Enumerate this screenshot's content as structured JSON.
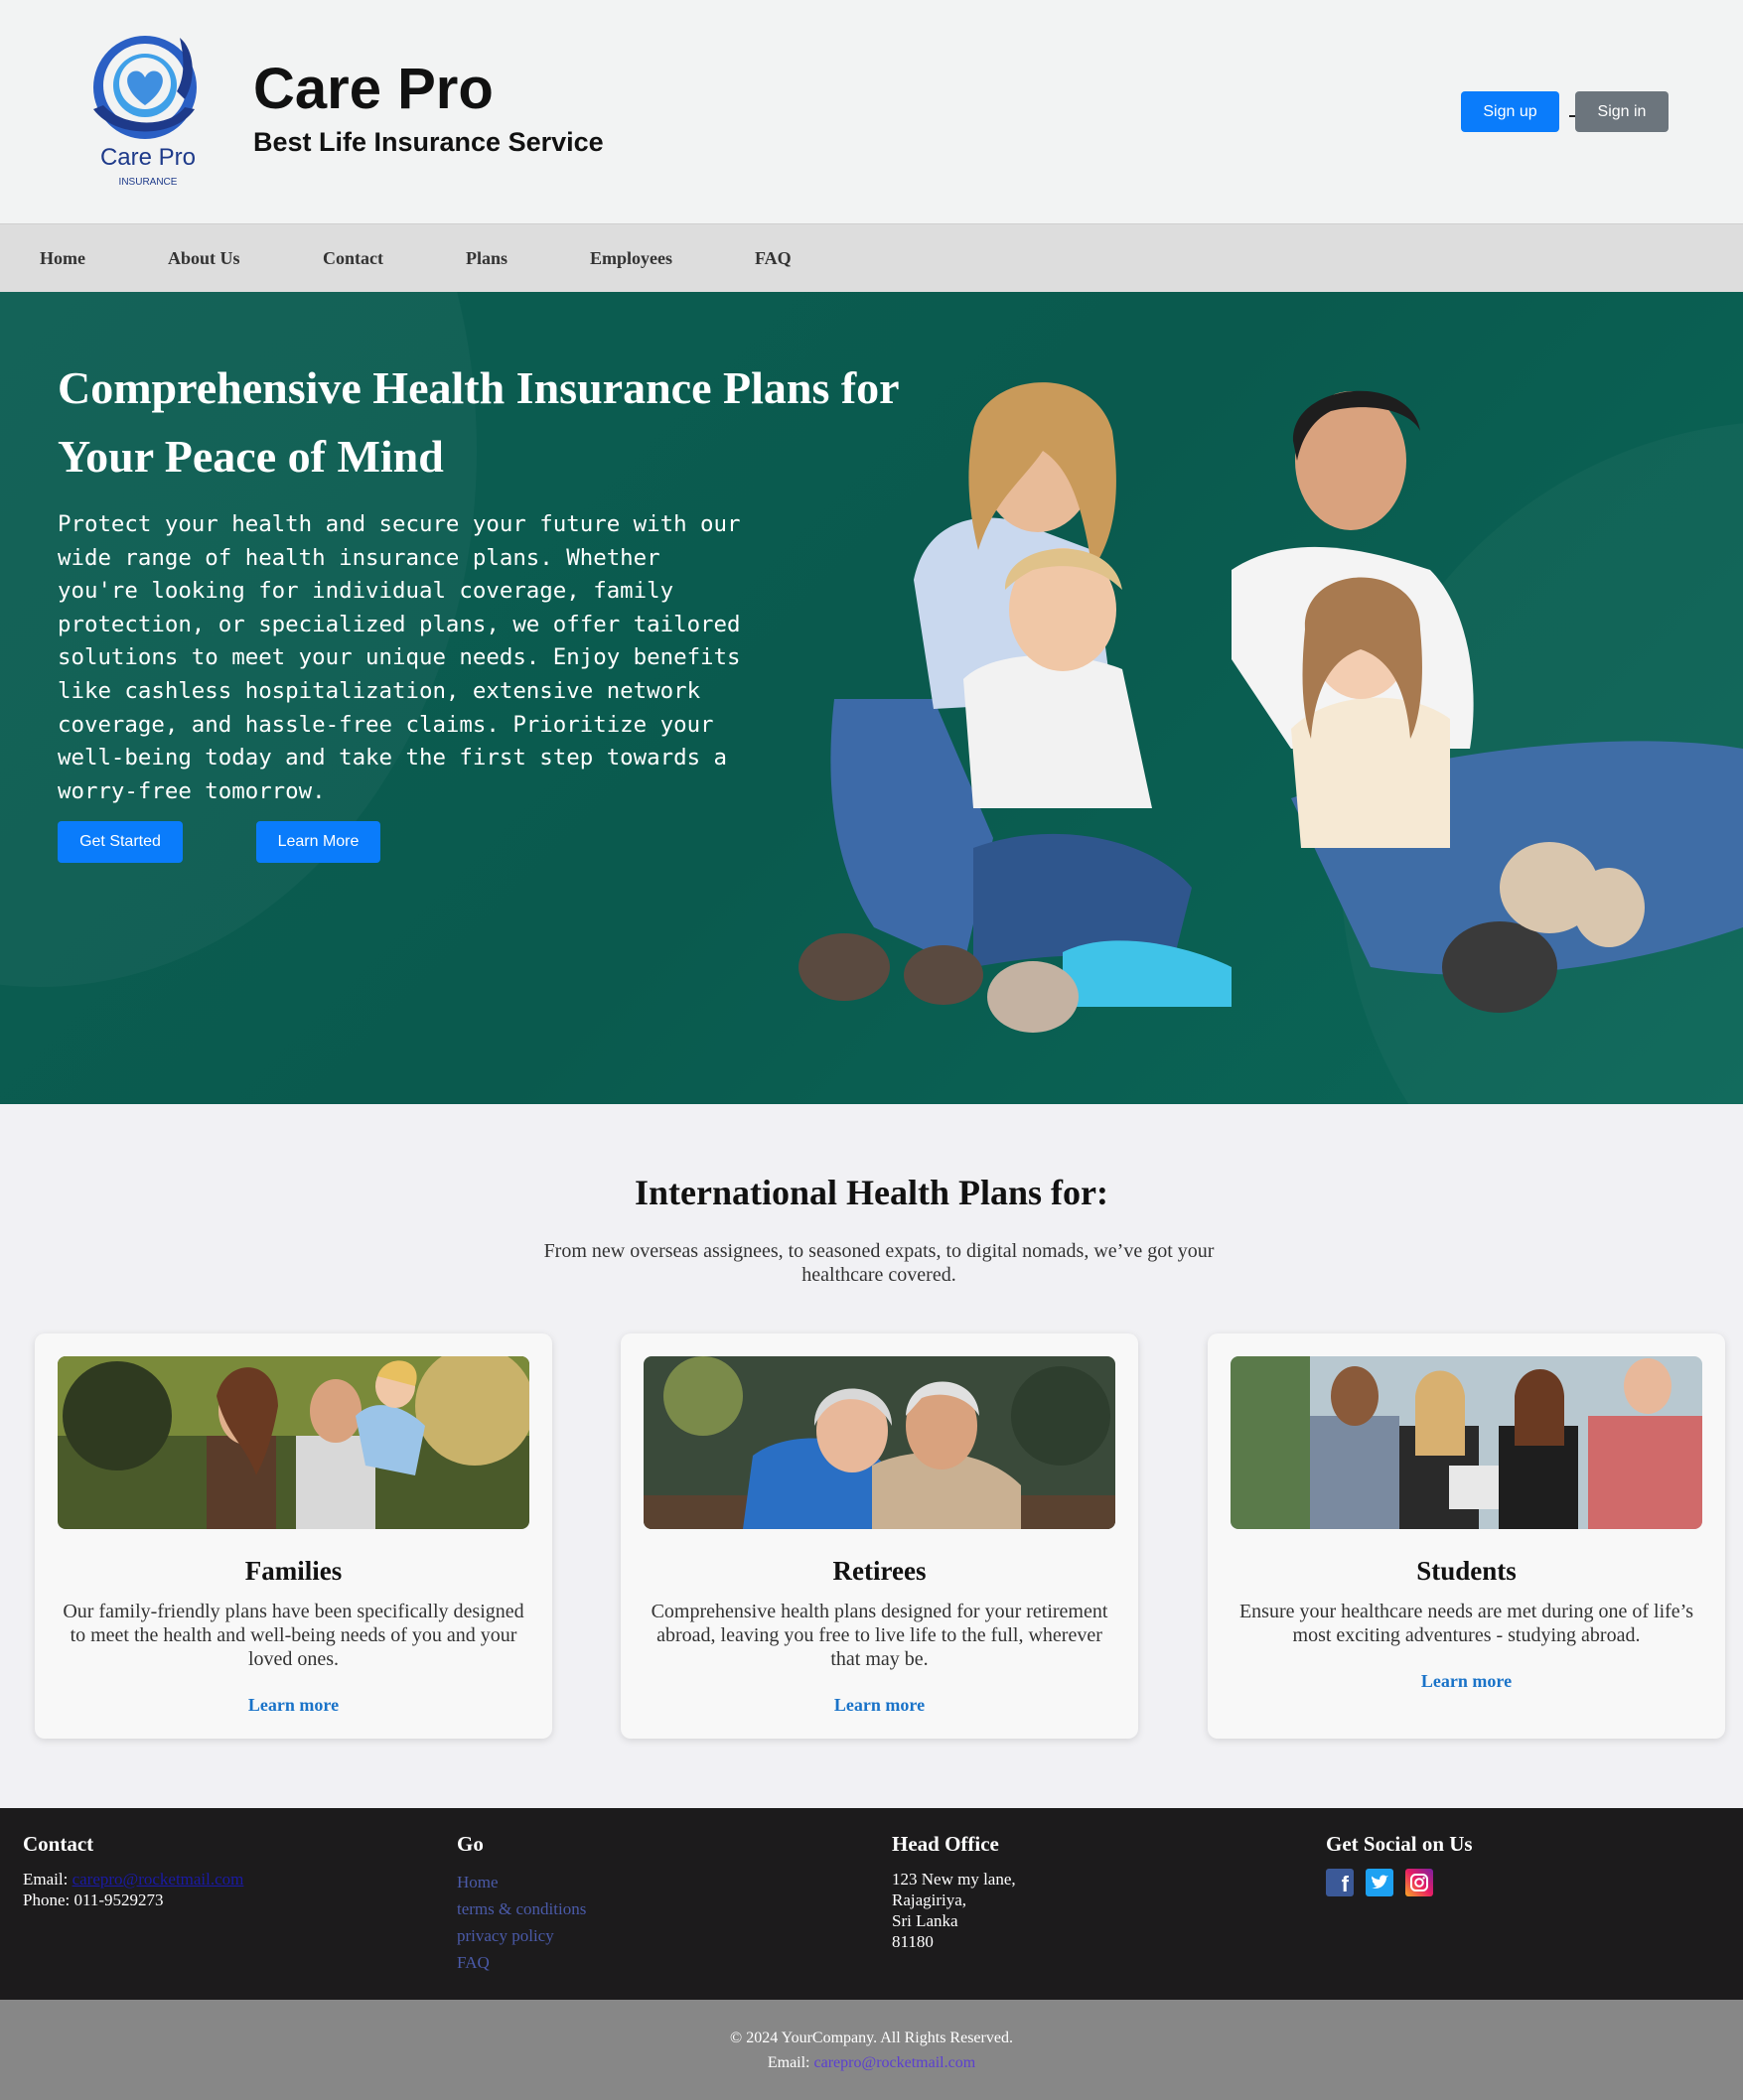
{
  "header": {
    "logo_text": "Care Pro",
    "logo_sub": "INSURANCE",
    "title": "Care Pro",
    "subtitle": "Best Life Insurance Service",
    "signup_label": "Sign up",
    "signin_label": "Sign in"
  },
  "nav": {
    "items": [
      "Home",
      "About Us",
      "Contact",
      "Plans",
      "Employees",
      "FAQ"
    ]
  },
  "hero": {
    "title": "Comprehensive Health Insurance Plans for Your Peace of Mind",
    "text": "Protect your health and secure your future with our wide range of health insurance plans. Whether you're looking for individual coverage, family protection, or specialized plans, we offer tailored solutions to meet your unique needs. Enjoy benefits like cashless hospitalization, extensive network coverage, and hassle-free claims. Prioritize your well-being today and take the first step towards a worry-free tomorrow.",
    "get_started_label": "Get Started",
    "learn_more_label": "Learn More"
  },
  "plans": {
    "title": "International Health Plans for:",
    "subtitle": "From new overseas assignees, to seasoned expats, to digital nomads, we’ve got your healthcare covered.",
    "cards": [
      {
        "title": "Families",
        "text": "Our family-friendly plans have been specifically designed to meet the health and well-being needs of you and your loved ones.",
        "link": "Learn more"
      },
      {
        "title": "Retirees",
        "text": "Comprehensive health plans designed for your retirement abroad, leaving you free to live life to the full, wherever that may be.",
        "link": "Learn more"
      },
      {
        "title": "Students",
        "text": "Ensure your healthcare needs are met during one of life’s most exciting adventures - studying abroad.",
        "link": "Learn more"
      }
    ]
  },
  "footer": {
    "contact": {
      "heading": "Contact",
      "email_label": "Email:",
      "email": "carepro@rocketmail.com",
      "phone_label": "Phone:",
      "phone": "011-9529273"
    },
    "go": {
      "heading": "Go",
      "links": [
        "Home",
        "terms & conditions",
        "privacy policy",
        "FAQ"
      ]
    },
    "office": {
      "heading": "Head Office",
      "lines": [
        "123 New my lane,",
        "Rajagiriya,",
        "Sri Lanka",
        "81180"
      ]
    },
    "social": {
      "heading": "Get Social on Us",
      "icons": [
        "facebook-icon",
        "twitter-icon",
        "instagram-icon"
      ]
    }
  },
  "bottom": {
    "copyright": "© 2024 YourCompany. All Rights Reserved.",
    "email_label": "Email:",
    "email": "carepro@rocketmail.com"
  },
  "colors": {
    "primary_button": "#0a7cfb",
    "secondary_button": "#6c757d",
    "hero_bg": "#0b5e52",
    "link": "#1a73c8",
    "footer_bg": "#1c1b1c"
  }
}
